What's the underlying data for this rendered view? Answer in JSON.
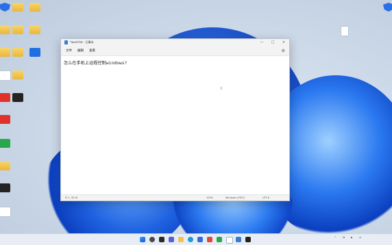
{
  "desktop": {
    "icons": [
      {
        "name": "desktop-icon-1",
        "label": "",
        "kind": "app-shield"
      },
      {
        "name": "desktop-icon-2",
        "label": "",
        "kind": "folder"
      },
      {
        "name": "desktop-icon-3",
        "label": "",
        "kind": "folder"
      },
      {
        "name": "desktop-icon-4",
        "label": "",
        "kind": "folder"
      },
      {
        "name": "desktop-icon-5",
        "label": "",
        "kind": "folder"
      },
      {
        "name": "desktop-icon-6",
        "label": "",
        "kind": "folder"
      },
      {
        "name": "desktop-icon-7",
        "label": "",
        "kind": "folder"
      },
      {
        "name": "desktop-icon-8",
        "label": "",
        "kind": "folder"
      },
      {
        "name": "desktop-icon-9",
        "label": "",
        "kind": "app-blue"
      },
      {
        "name": "desktop-icon-10",
        "label": "",
        "kind": "app-white"
      },
      {
        "name": "desktop-icon-11",
        "label": "",
        "kind": "folder"
      },
      {
        "name": "desktop-icon-12",
        "label": "",
        "kind": "app-red"
      },
      {
        "name": "desktop-icon-13",
        "label": "",
        "kind": "app-dark"
      },
      {
        "name": "desktop-icon-14",
        "label": "",
        "kind": "app-red"
      },
      {
        "name": "desktop-icon-15",
        "label": "",
        "kind": "app-green"
      },
      {
        "name": "desktop-icon-16",
        "label": "",
        "kind": "folder"
      },
      {
        "name": "desktop-icon-17",
        "label": "",
        "kind": "app-dark"
      },
      {
        "name": "desktop-icon-18",
        "label": "",
        "kind": "app-white"
      },
      {
        "name": "desktop-icon-19",
        "label": "",
        "kind": "app-white"
      }
    ]
  },
  "notepad": {
    "title": "*word.txt - 记事本",
    "menu": [
      "文件",
      "编辑",
      "查看"
    ],
    "content": "怎么在手机上远程控制windows?",
    "status": {
      "position": "行 1, 列 16",
      "zoom": "100%",
      "line_ending": "Windows (CRLF)",
      "encoding": "UTF-8"
    },
    "controls": {
      "minimize": "—",
      "maximize": "□",
      "close": "✕"
    }
  },
  "taskbar": {
    "tray_left": "^",
    "clock_time": "",
    "clock_date": ""
  }
}
